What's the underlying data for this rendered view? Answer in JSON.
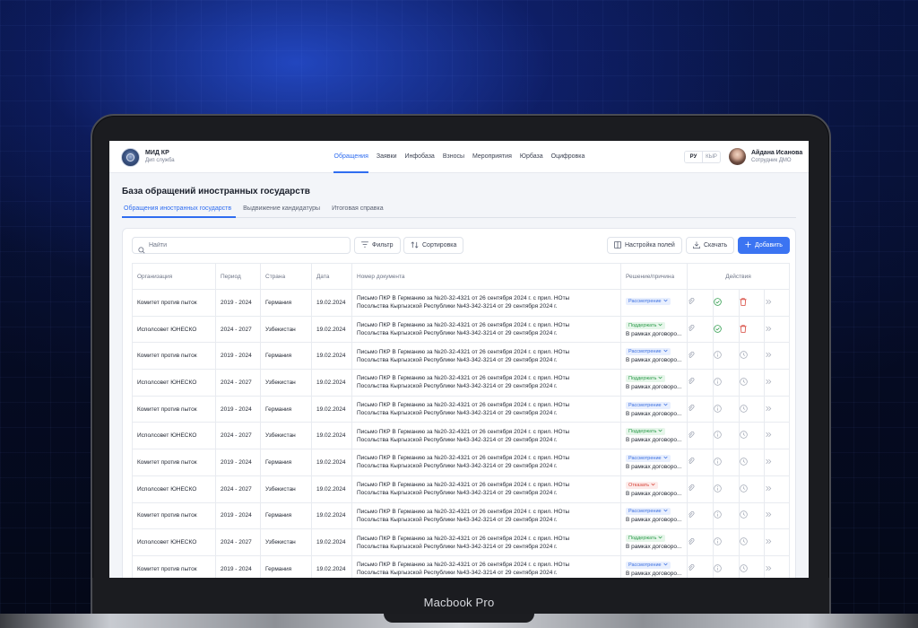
{
  "device_label": "Macbook Pro",
  "header": {
    "brand_title": "МИД КР",
    "brand_sub": "Дип служба",
    "nav": [
      {
        "label": "Обращения",
        "active": true
      },
      {
        "label": "Заявки",
        "active": false
      },
      {
        "label": "Инфобаза",
        "active": false
      },
      {
        "label": "Взносы",
        "active": false
      },
      {
        "label": "Мероприятия",
        "active": false
      },
      {
        "label": "Юрбаза",
        "active": false
      },
      {
        "label": "Оцифровка",
        "active": false
      }
    ],
    "lang": [
      {
        "label": "РУ",
        "active": true
      },
      {
        "label": "КЫР",
        "active": false
      }
    ],
    "user_name": "Айдана Исанова",
    "user_role": "Сотрудник ДМО"
  },
  "page": {
    "title": "База обращений иностранных государств",
    "tabs": [
      {
        "label": "Обращения иностранных государств",
        "active": true
      },
      {
        "label": "Выдвижение кандидатуры",
        "active": false
      },
      {
        "label": "Итоговая справка",
        "active": false
      }
    ]
  },
  "toolbar": {
    "search_placeholder": "Найти",
    "filter_label": "Фильтр",
    "sort_label": "Сортировка",
    "fields_label": "Настройка полей",
    "download_label": "Скачать",
    "add_label": "Добавить"
  },
  "table": {
    "columns": [
      "Организация",
      "Период",
      "Страна",
      "Дата",
      "Номер документа",
      "Решение/причина",
      "Действия"
    ],
    "rows": [
      {
        "org": "Комитет против пыток",
        "period": "2019 - 2024",
        "country": "Германия",
        "date": "19.02.2024",
        "doc1": "Письмо ПКР В Германию за №20-32-4321 от 26 сентября 2024 г. с прил. НОты",
        "doc2": "Посольства Кыргызской Республики №43-342-3214 от 29 сентября 2024 г.",
        "status": "Рассмотрение",
        "status_kind": "blue",
        "reason": "",
        "actions": "done"
      },
      {
        "org": "Исполсовет ЮНЕСКО",
        "period": "2024 - 2027",
        "country": "Узбекистан",
        "date": "19.02.2024",
        "doc1": "Письмо ПКР В Германию за №20-32-4321 от 26 сентября 2024 г. с прил. НОты",
        "doc2": "Посольства Кыргызской Республики №43-342-3214 от 29 сентября 2024 г.",
        "status": "Поддержать",
        "status_kind": "green",
        "reason": "В рамках договоро...",
        "actions": "done"
      },
      {
        "org": "Комитет против пыток",
        "period": "2019 - 2024",
        "country": "Германия",
        "date": "19.02.2024",
        "doc1": "Письмо ПКР В Германию за №20-32-4321 от 26 сентября 2024 г. с прил. НОты",
        "doc2": "Посольства Кыргызской Республики №43-342-3214 от 29 сентября 2024 г.",
        "status": "Рассмотрение",
        "status_kind": "blue",
        "reason": "В рамках договоро...",
        "actions": "pending"
      },
      {
        "org": "Исполсовет ЮНЕСКО",
        "period": "2024 - 2027",
        "country": "Узбекистан",
        "date": "19.02.2024",
        "doc1": "Письмо ПКР В Германию за №20-32-4321 от 26 сентября 2024 г. с прил. НОты",
        "doc2": "Посольства Кыргызской Республики №43-342-3214 от 29 сентября 2024 г.",
        "status": "Поддержать",
        "status_kind": "green",
        "reason": "В рамках договоро...",
        "actions": "pending"
      },
      {
        "org": "Комитет против пыток",
        "period": "2019 - 2024",
        "country": "Германия",
        "date": "19.02.2024",
        "doc1": "Письмо ПКР В Германию за №20-32-4321 от 26 сентября 2024 г. с прил. НОты",
        "doc2": "Посольства Кыргызской Республики №43-342-3214 от 29 сентября 2024 г.",
        "status": "Рассмотрение",
        "status_kind": "blue",
        "reason": "В рамках договоро...",
        "actions": "pending"
      },
      {
        "org": "Исполсовет ЮНЕСКО",
        "period": "2024 - 2027",
        "country": "Узбекистан",
        "date": "19.02.2024",
        "doc1": "Письмо ПКР В Германию за №20-32-4321 от 26 сентября 2024 г. с прил. НОты",
        "doc2": "Посольства Кыргызской Республики №43-342-3214 от 29 сентября 2024 г.",
        "status": "Поддержать",
        "status_kind": "green",
        "reason": "В рамках договоро...",
        "actions": "pending"
      },
      {
        "org": "Комитет против пыток",
        "period": "2019 - 2024",
        "country": "Германия",
        "date": "19.02.2024",
        "doc1": "Письмо ПКР В Германию за №20-32-4321 от 26 сентября 2024 г. с прил. НОты",
        "doc2": "Посольства Кыргызской Республики №43-342-3214 от 29 сентября 2024 г.",
        "status": "Рассмотрение",
        "status_kind": "blue",
        "reason": "В рамках договоро...",
        "actions": "pending"
      },
      {
        "org": "Исполсовет ЮНЕСКО",
        "period": "2024 - 2027",
        "country": "Узбекистан",
        "date": "19.02.2024",
        "doc1": "Письмо ПКР В Германию за №20-32-4321 от 26 сентября 2024 г. с прил. НОты",
        "doc2": "Посольства Кыргызской Республики №43-342-3214 от 29 сентября 2024 г.",
        "status": "Отказать",
        "status_kind": "red",
        "reason": "В рамках договоро...",
        "actions": "pending"
      },
      {
        "org": "Комитет против пыток",
        "period": "2019 - 2024",
        "country": "Германия",
        "date": "19.02.2024",
        "doc1": "Письмо ПКР В Германию за №20-32-4321 от 26 сентября 2024 г. с прил. НОты",
        "doc2": "Посольства Кыргызской Республики №43-342-3214 от 29 сентября 2024 г.",
        "status": "Рассмотрение",
        "status_kind": "blue",
        "reason": "В рамках договоро...",
        "actions": "pending"
      },
      {
        "org": "Исполсовет ЮНЕСКО",
        "period": "2024 - 2027",
        "country": "Узбекистан",
        "date": "19.02.2024",
        "doc1": "Письмо ПКР В Германию за №20-32-4321 от 26 сентября 2024 г. с прил. НОты",
        "doc2": "Посольства Кыргызской Республики №43-342-3214 от 29 сентября 2024 г.",
        "status": "Поддержать",
        "status_kind": "green",
        "reason": "В рамках договоро...",
        "actions": "pending"
      },
      {
        "org": "Комитет против пыток",
        "period": "2019 - 2024",
        "country": "Германия",
        "date": "19.02.2024",
        "doc1": "Письмо ПКР В Германию за №20-32-4321 от 26 сентября 2024 г. с прил. НОты",
        "doc2": "Посольства Кыргызской Республики №43-342-3214 от 29 сентября 2024 г.",
        "status": "Рассмотрение",
        "status_kind": "blue",
        "reason": "В рамках договоро...",
        "actions": "pending"
      }
    ]
  },
  "colors": {
    "accent": "#2f6df0",
    "primary_button": "#3b74f2",
    "status_blue": "#3b6fe0",
    "status_green": "#2e9c4c",
    "status_red": "#d6453a"
  },
  "icons": {
    "search": "search-icon",
    "filter": "filter-icon",
    "sort": "sort-icon",
    "fields": "columns-icon",
    "download": "download-icon",
    "add": "plus-icon",
    "attach": "paperclip-icon",
    "approved": "check-circle-icon",
    "info": "info-icon",
    "delete": "trash-icon",
    "pending": "clock-icon",
    "more": "double-chevron-right-icon"
  }
}
